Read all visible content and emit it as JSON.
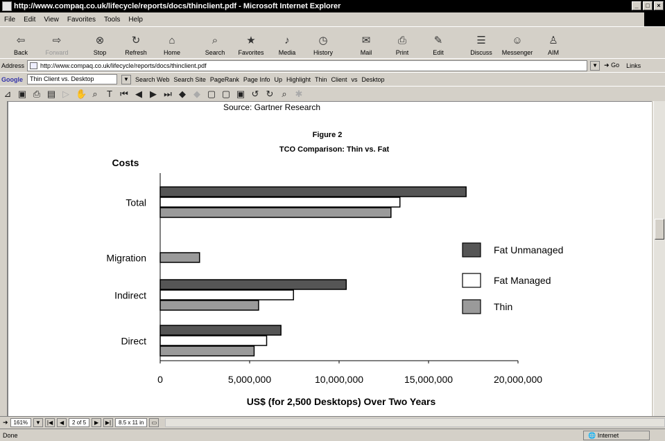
{
  "window": {
    "title": "http://www.compaq.co.uk/lifecycle/reports/docs/thinclient.pdf - Microsoft Internet Explorer"
  },
  "menu": [
    "File",
    "Edit",
    "View",
    "Favorites",
    "Tools",
    "Help"
  ],
  "toolbar": [
    {
      "label": "Back",
      "icon": "back-arrow-icon",
      "glyph": "⇦",
      "disabled": false
    },
    {
      "label": "Forward",
      "icon": "forward-arrow-icon",
      "glyph": "⇨",
      "disabled": true
    },
    {
      "label": "Stop",
      "icon": "stop-icon",
      "glyph": "⊗",
      "disabled": false
    },
    {
      "label": "Refresh",
      "icon": "refresh-icon",
      "glyph": "↻",
      "disabled": false
    },
    {
      "label": "Home",
      "icon": "home-icon",
      "glyph": "⌂",
      "disabled": false
    },
    {
      "label": "Search",
      "icon": "search-icon",
      "glyph": "⌕",
      "disabled": false
    },
    {
      "label": "Favorites",
      "icon": "favorites-icon",
      "glyph": "★",
      "disabled": false
    },
    {
      "label": "Media",
      "icon": "media-icon",
      "glyph": "♪",
      "disabled": false
    },
    {
      "label": "History",
      "icon": "history-icon",
      "glyph": "◷",
      "disabled": false
    },
    {
      "label": "Mail",
      "icon": "mail-icon",
      "glyph": "✉",
      "disabled": false
    },
    {
      "label": "Print",
      "icon": "print-icon",
      "glyph": "⎙",
      "disabled": false
    },
    {
      "label": "Edit",
      "icon": "edit-icon",
      "glyph": "✎",
      "disabled": false
    },
    {
      "label": "Discuss",
      "icon": "discuss-icon",
      "glyph": "☰",
      "disabled": false
    },
    {
      "label": "Messenger",
      "icon": "messenger-icon",
      "glyph": "☺",
      "disabled": false
    },
    {
      "label": "AIM",
      "icon": "aim-icon",
      "glyph": "♙",
      "disabled": false
    }
  ],
  "address": {
    "label": "Address",
    "url": "http://www.compaq.co.uk/lifecycle/reports/docs/thinclient.pdf",
    "go": "Go",
    "links": "Links"
  },
  "googlebar": {
    "logo": "Google",
    "query": "Thin Client vs. Desktop",
    "buttons": [
      "Search Web",
      "Search Site",
      "PageRank",
      "Page Info",
      "Up",
      "Highlight",
      "Thin",
      "Client",
      "vs",
      "Desktop"
    ]
  },
  "pdf": {
    "zoom": "161%",
    "page": "2 of 5",
    "size": "8.5 x 11 in"
  },
  "status": {
    "text": "Done",
    "zone": "Internet"
  },
  "document": {
    "source": "Source: Gartner Research",
    "figure": "Figure 2"
  },
  "colors": {
    "fat_unmanaged": "#555555",
    "fat_managed": "#ffffff",
    "thin": "#9a9a9a"
  },
  "chart_data": {
    "type": "bar",
    "orientation": "horizontal",
    "title": "TCO Comparison: Thin vs. Fat",
    "ylabel": "Costs",
    "xlabel": "US$ (for 2,500 Desktops) Over Two Years",
    "categories": [
      "Total",
      "Migration",
      "Indirect",
      "Direct"
    ],
    "series": [
      {
        "name": "Fat Unmanaged",
        "values": [
          17100000,
          null,
          10400000,
          6750000
        ]
      },
      {
        "name": "Fat Managed",
        "values": [
          13400000,
          null,
          7450000,
          5950000
        ]
      },
      {
        "name": "Thin",
        "values": [
          12900000,
          2200000,
          5500000,
          5250000
        ]
      }
    ],
    "xlim": [
      0,
      20000000
    ],
    "xticks": [
      "0",
      "5,000,000",
      "10,000,000",
      "15,000,000",
      "20,000,000"
    ],
    "legend_position": "right",
    "grid": false
  }
}
